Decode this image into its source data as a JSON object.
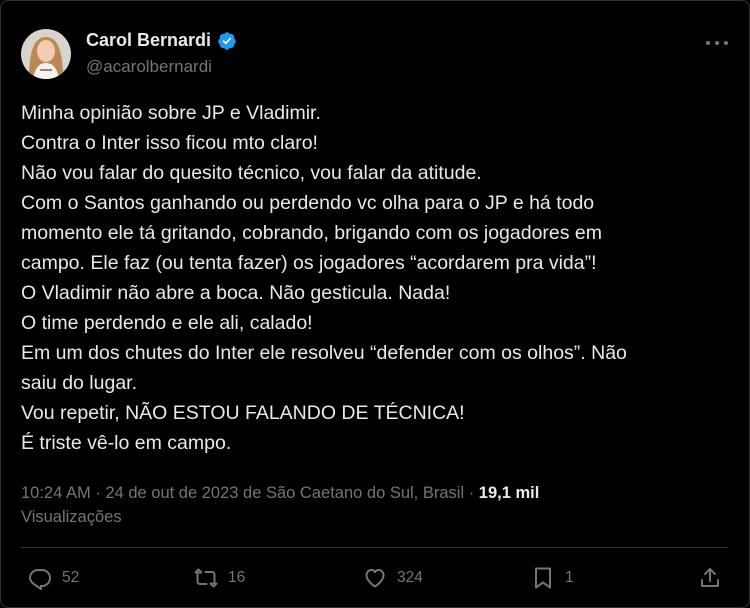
{
  "author": {
    "name": "Carol Bernardi",
    "handle": "@acarolbernardi",
    "verified": true
  },
  "tweet": {
    "lines": [
      "Minha opinião sobre JP e Vladimir.",
      "Contra o Inter isso ficou mto claro!",
      "Não vou falar do quesito técnico, vou falar da atitude.",
      "Com o Santos ganhando ou perdendo vc olha para o JP e há todo",
      "momento ele tá gritando, cobrando, brigando com os jogadores em",
      "campo. Ele faz (ou tenta fazer) os jogadores “acordarem pra vida”!",
      "O Vladimir não abre a boca. Não gesticula. Nada!",
      "O time perdendo e ele ali, calado!",
      "Em um dos chutes do Inter ele resolveu “defender com os olhos”. Não",
      "saiu do lugar.",
      "Vou repetir, NÃO ESTOU FALANDO DE TÉCNICA!",
      "É triste vê-lo em campo."
    ]
  },
  "meta": {
    "time": "10:24 AM",
    "date": "24 de out de 2023",
    "location": "de São Caetano do Sul, Brasil",
    "views_count": "19,1 mil",
    "views_label": "Visualizações"
  },
  "actions": {
    "replies": "52",
    "retweets": "16",
    "likes": "324",
    "bookmarks": "1"
  },
  "colors": {
    "background": "#000000",
    "text": "#e7e9ea",
    "secondary": "#71767b",
    "verified": "#1d9bf0"
  }
}
